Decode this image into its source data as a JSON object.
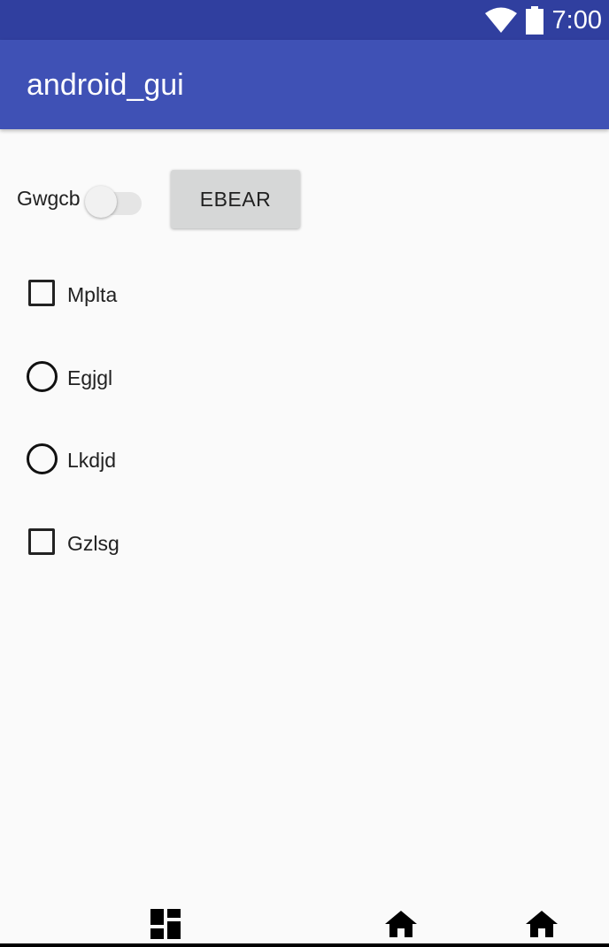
{
  "status_bar": {
    "time": "7:00",
    "wifi_icon": "wifi-icon",
    "battery_icon": "battery-icon",
    "bg_color": "#303F9F"
  },
  "app_bar": {
    "title": "android_gui",
    "bg_color": "#3F51B5"
  },
  "controls": {
    "switch": {
      "label": "Gwgcb",
      "checked": false
    },
    "button": {
      "label": "EBEAR"
    },
    "options": [
      {
        "type": "checkbox",
        "label": "Mplta",
        "checked": false
      },
      {
        "type": "radio",
        "label": "Egjgl",
        "checked": false
      },
      {
        "type": "radio",
        "label": "Lkdjd",
        "checked": false
      },
      {
        "type": "checkbox",
        "label": "Gzlsg",
        "checked": false
      }
    ]
  },
  "nav_bar": {
    "buttons": [
      "dashboard-icon",
      "home-icon",
      "home-icon"
    ]
  }
}
